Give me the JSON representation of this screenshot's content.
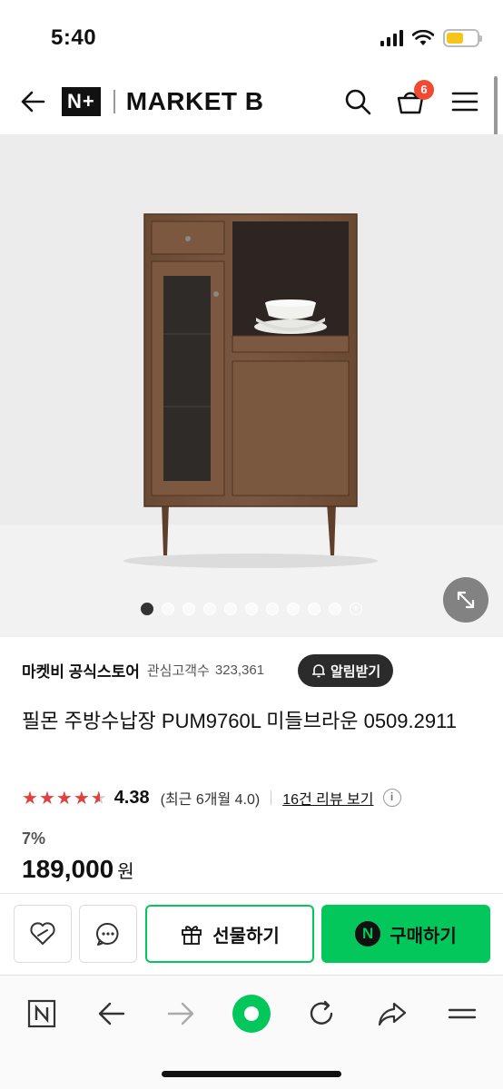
{
  "status_bar": {
    "time": "5:40",
    "battery_level": 0.55
  },
  "header": {
    "logo_mark": "N+",
    "logo_text": "MARKET B",
    "cart_count": "6",
    "icons": [
      "back-arrow-icon",
      "search-icon",
      "cart-icon",
      "menu-icon"
    ]
  },
  "gallery": {
    "image_count": 10,
    "active_index": 0,
    "has_more": true
  },
  "store": {
    "name": "마켓비 공식스토어",
    "followers_label": "관심고객수",
    "followers_count": "323,361",
    "notify_label": "알림받기"
  },
  "product": {
    "title": "필몬 주방수납장 PUM9760L 미들브라운 0509.2911",
    "rating": "4.38",
    "rating_value": 4.38,
    "rating_recent": "(최근 6개월 4.0)",
    "review_link": "16건 리뷰 보기",
    "discount": "7%",
    "price": "189,000",
    "price_unit": "원"
  },
  "actions": {
    "gift_label": "선물하기",
    "buy_label": "구매하기",
    "buy_mark": "N"
  },
  "colors": {
    "naver_green": "#03c75a",
    "star_red": "#e0413d",
    "badge_red": "#f04a32"
  }
}
